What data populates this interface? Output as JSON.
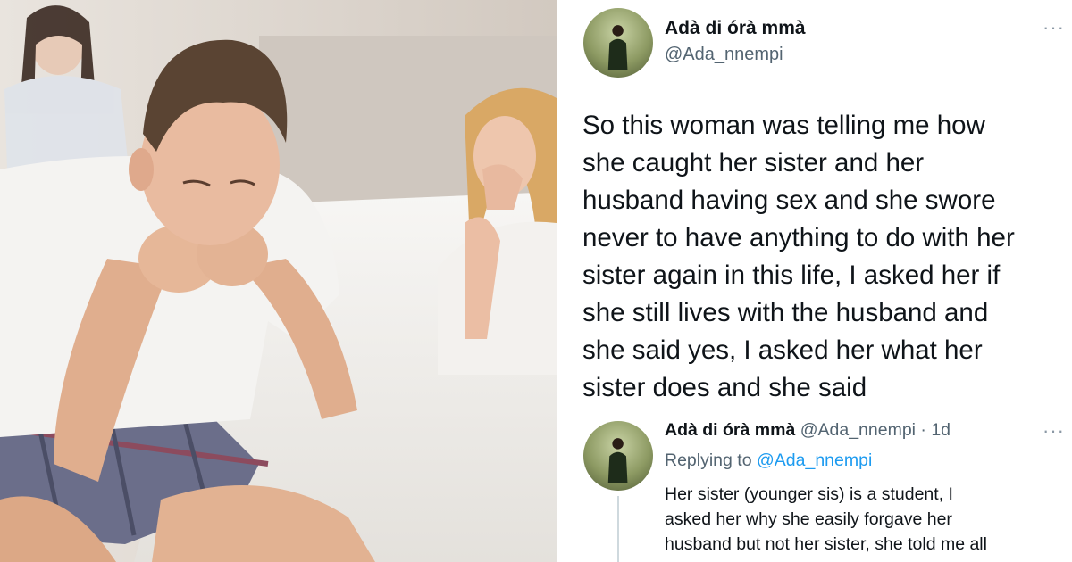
{
  "tweet": {
    "author_name": "Adà di órà mmà",
    "handle": "@Ada_nnempi",
    "more_glyph": "···",
    "lines": [
      "So this woman was telling me how",
      "she caught her sister and her",
      "husband having sex and she swore",
      "never to have anything to do with her",
      "sister again in this life, I asked her if",
      "she still lives with the husband and",
      "she said yes, I asked her what her",
      "sister does and she said"
    ]
  },
  "reply": {
    "author_name": "Adà di órà mmà",
    "handle_time": "@Ada_nnempi · 1d",
    "replying_prefix": "Replying to ",
    "replying_mention": "@Ada_nnempi",
    "more_glyph": "···",
    "lines": [
      "Her sister (younger sis) is a student, I",
      "asked her why she easily forgave her",
      "husband but not her sister, she told me all"
    ]
  },
  "colors": {
    "text": "#0f1419",
    "secondary": "#536471",
    "link": "#1d9bf0",
    "thread_line": "#cfd9de"
  }
}
